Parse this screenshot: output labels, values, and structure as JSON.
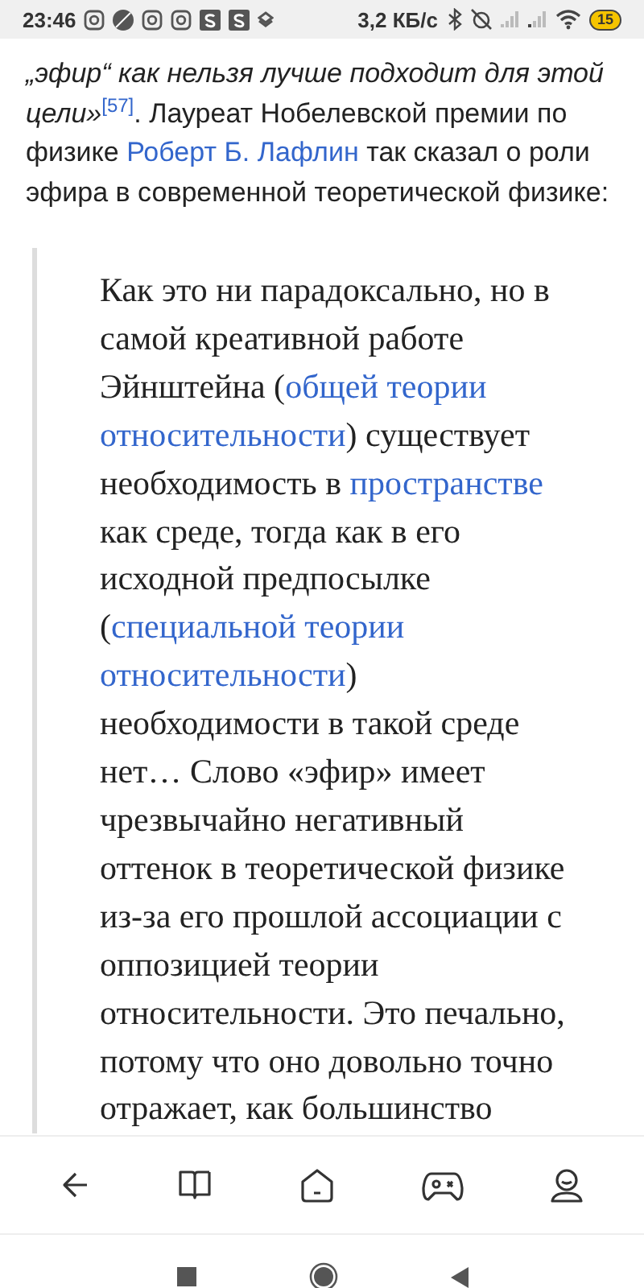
{
  "status_bar": {
    "time": "23:46",
    "speed": "3,2 КБ/с",
    "battery": "15"
  },
  "intro": [
    {
      "kind": "italic",
      "text": "„эфир“ как нельзя лучше подходит для этой цели»"
    },
    {
      "kind": "ref",
      "text": "[57]"
    },
    {
      "kind": "text",
      "text": ". Лауреат Нобелевской премии по физике "
    },
    {
      "kind": "link",
      "text": "Роберт Б. Лафлин"
    },
    {
      "kind": "text",
      "text": " так сказал о роли эфира в современной теоретической физике:"
    }
  ],
  "quote": [
    {
      "kind": "text",
      "text": "Как это ни парадоксально, но в самой креативной работе Эйнштейна ("
    },
    {
      "kind": "link",
      "text": "общей теории"
    },
    {
      "kind": "link",
      "text": "относительности"
    },
    {
      "kind": "text",
      "text": ") существует необходимость в "
    },
    {
      "kind": "link",
      "text": "пространстве"
    },
    {
      "kind": "text",
      "text": " как среде, тогда как в его исходной предпосылке ("
    },
    {
      "kind": "link",
      "text": "специальной теории"
    },
    {
      "kind": "link",
      "text": "относительности"
    },
    {
      "kind": "text",
      "text": ") необходимости в такой среде нет… Слово «эфир» имеет чрезвычайно негативный оттенок в теоретической физике из-за его прошлой ассоциации с оппозицией теории относительности. Это печально, потому что оно довольно точно отражает, как большинство"
    }
  ]
}
